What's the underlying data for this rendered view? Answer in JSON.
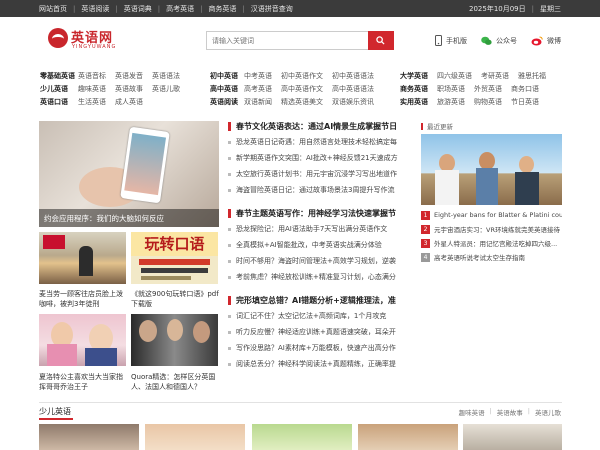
{
  "topbar": {
    "nav": [
      "网站首页",
      "英语阅读",
      "英语词典",
      "高考英语",
      "商务英语",
      "汉语拼音查询"
    ],
    "date": "2025年10月09日",
    "weekday": "星期三"
  },
  "logo": {
    "name": "英语网",
    "sub": "YINGYUWANG"
  },
  "search": {
    "placeholder": "请输入关键词"
  },
  "header_links": [
    {
      "label": "手机版",
      "icon": "mobile-icon"
    },
    {
      "label": "公众号",
      "icon": "wechat-icon"
    },
    {
      "label": "微博",
      "icon": "weibo-icon"
    }
  ],
  "nav": {
    "col1": [
      {
        "head": "零基础英语",
        "items": [
          "英语音标",
          "英语发音",
          "英语语法"
        ]
      },
      {
        "head": "少儿英语",
        "items": [
          "趣味英语",
          "英语故事",
          "英语儿歌"
        ]
      },
      {
        "head": "英语口语",
        "items": [
          "生活英语",
          "成人英语"
        ]
      }
    ],
    "col2": [
      {
        "head": "初中英语",
        "items": [
          "中考英语",
          "初中英语作文",
          "初中英语语法"
        ]
      },
      {
        "head": "高中英语",
        "items": [
          "高考英语",
          "高中英语作文",
          "高中英语语法"
        ]
      },
      {
        "head": "英语阅读",
        "items": [
          "双语新闻",
          "精选英语美文",
          "双语娱乐资讯"
        ]
      }
    ],
    "col3": [
      {
        "head": "大学英语",
        "items": [
          "四六级英语",
          "考研英语",
          "雅思托福"
        ]
      },
      {
        "head": "商务英语",
        "items": [
          "职场英语",
          "外贸英语",
          "商务口语"
        ]
      },
      {
        "head": "实用英语",
        "items": [
          "旅游英语",
          "购物英语",
          "节日英语"
        ]
      }
    ]
  },
  "hero": {
    "caption": "约会应用程序：我们的大脑如何反应"
  },
  "thumbs": [
    {
      "caption": "麦当劳一顾客往店员脸上泼咖啡，被判3年徒刑"
    },
    {
      "caption": "《就这900句玩转口语》pdf下载版",
      "overlay": "玩转口语"
    },
    {
      "caption": "夏洛特公主喜欢当大当家指挥哥哥乔治王子"
    },
    {
      "caption": "Quora精选：怎样区分英国人、法国人和德国人？"
    }
  ],
  "sections": [
    {
      "title": "春节文化英语表达：通过AI情景生成掌握节日",
      "items": [
        "恐龙英语日记奇遇：用自然语言处理技术轻松搞定每",
        "新学期英语作文突围：AI批改+神经反馈21天速成方",
        "太空旅行英语计划书：用元宇宙沉浸学习写出地道作",
        "海盗冒险英语日记：通过故事场景法3周提升写作流"
      ]
    },
    {
      "title": "春节主题英语写作：用神经学习法快速掌握节",
      "items": [
        "恐龙探险记：用AI语法助手7天写出满分英语作文",
        "全真模拟+AI智能批改，中考英语实战满分体验",
        "时间不够用？海盗时间管理法+高效学习规划，逆袭",
        "考前焦虑？神经放松训练+精准复习计划，心态满分"
      ]
    },
    {
      "title": "完形填空总错？AI错题分析+逻辑推理法，准",
      "items": [
        "词汇记不住？太空记忆法+高频词库，1个月攻克",
        "听力反应慢？神经适应训练+真题语速突破，耳朵开",
        "写作没思路？AI素材库+万能模板，快速产出高分作",
        "阅读总丢分？神经科学阅读法+真题精练，正确率提"
      ]
    }
  ],
  "recent": {
    "title": "最近更新",
    "items": [
      "Eight-year bans for Blatter & Platini could ...",
      "元宇宙酒店实习：VR环境练就完美英语接待",
      "外星人特派员：用记忆宫殿法吃掉四六级...",
      "高考英语听说考试太空生存指南"
    ]
  },
  "bottom": {
    "title": "少儿英语",
    "links": [
      "趣味英语",
      "英语故事",
      "英语儿歌"
    ]
  },
  "colors": {
    "accent": "#d1272d",
    "topbar": "#3b3b3b"
  }
}
